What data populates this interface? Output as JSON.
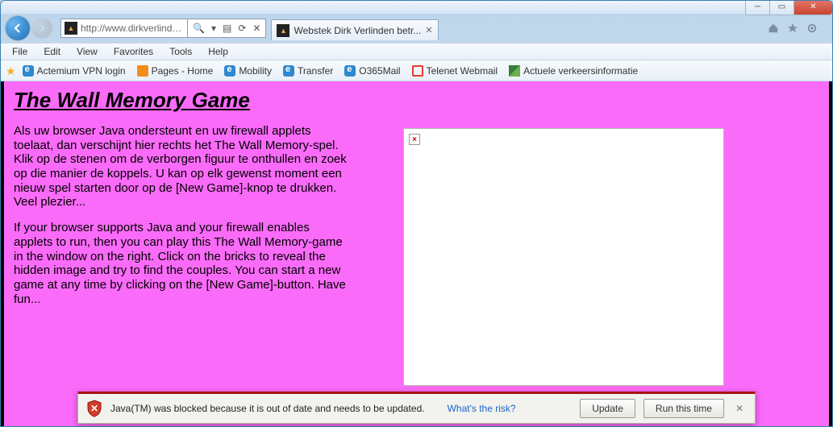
{
  "window": {
    "address_url": "http://www.dirkverlinde...",
    "tab_title": "Webstek Dirk Verlinden betr..."
  },
  "menu": {
    "items": [
      "File",
      "Edit",
      "View",
      "Favorites",
      "Tools",
      "Help"
    ]
  },
  "bookmarks": {
    "items": [
      {
        "icon": "ie",
        "label": "Actemium VPN login"
      },
      {
        "icon": "orange",
        "label": "Pages - Home"
      },
      {
        "icon": "ie",
        "label": "Mobility"
      },
      {
        "icon": "ie",
        "label": "Transfer"
      },
      {
        "icon": "ie",
        "label": "O365Mail"
      },
      {
        "icon": "red",
        "label": "Telenet Webmail"
      },
      {
        "icon": "green",
        "label": "Actuele verkeersinformatie"
      }
    ]
  },
  "page": {
    "title": "The Wall Memory Game",
    "para_nl": "Als uw browser Java ondersteunt en uw firewall applets toelaat, dan verschijnt hier rechts het The Wall Memory-spel. Klik op de stenen om de verborgen figuur te onthullen en zoek op die manier de koppels. U kan op elk gewenst moment een nieuw spel starten door op de [New Game]-knop te drukken. Veel plezier...",
    "para_en": "If your browser supports Java and your firewall enables applets to run, then you can play this The Wall Memory-game in the window on the right. Click on the bricks to reveal the hidden image and try to find the couples. You can start a new game at any time by clicking on the [New Game]-button. Have fun..."
  },
  "applet": {
    "broken": "×"
  },
  "notify": {
    "message": "Java(TM) was blocked because it is out of date and needs to be updated.",
    "link": "What's the risk?",
    "update": "Update",
    "run": "Run this time"
  },
  "search_hint": "𝄎",
  "nav_symbols": {
    "refresh": "⟳",
    "stop": "✕",
    "compat": "▤",
    "search": "🔍",
    "dropdown": "▾"
  }
}
